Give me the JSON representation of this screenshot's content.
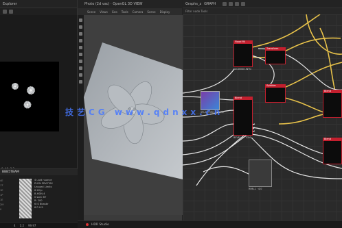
{
  "left_panel": {
    "title": "Explorer",
    "coord": "0, 40, 2.2",
    "lower_title": "BBB5TBAM",
    "props": [
      "4 uuid nuance",
      "PHYN PRYOTAS",
      "Unsued Limits",
      "6 X2/p",
      "B-HDN-4",
      "0 ssec BT",
      "R: 200",
      "6 IS Bbasbr",
      "8 P-0-5"
    ],
    "gutter": [
      "4E",
      "1T",
      "1E",
      "1P",
      "1E",
      "2M",
      "0"
    ],
    "status": [
      "4",
      "1:2",
      "99.97"
    ]
  },
  "view3d": {
    "title": "Photo (2d vac) · OpenGL  3D VIEW",
    "menu": [
      "Scene",
      "Views",
      "Geo",
      "Tools",
      "Camera",
      "Scene",
      "Display"
    ],
    "status": "HDR Studio"
  },
  "graph": {
    "title": "Graphs_z",
    "title_right": "GRAPH",
    "path": "Filter node Tools",
    "nodes": [
      {
        "head": "Flood Fill",
        "label": "ED-NOISE-INTG"
      },
      {
        "head": "Transform",
        "label": ""
      },
      {
        "head": "Splatter",
        "label": ""
      },
      {
        "head": "Blend",
        "label": "BEVEL-2 · TOM"
      },
      {
        "head": "Blend",
        "label": "SHAPE-2 · TOR"
      },
      {
        "head": "Tile",
        "label": "SPLAT-CIRCULAR-TIL"
      },
      {
        "head": "Blend",
        "label": ""
      },
      {
        "head": "Blend",
        "label": ""
      },
      {
        "head": "Output",
        "label": "RHN-1 · 4.0"
      }
    ]
  },
  "watermark": "技艺CG  www.qdnxx.cn",
  "colors": {
    "node_red": "#c41f2e",
    "wire": "#e8c24a",
    "watermark": "#4678ff"
  }
}
